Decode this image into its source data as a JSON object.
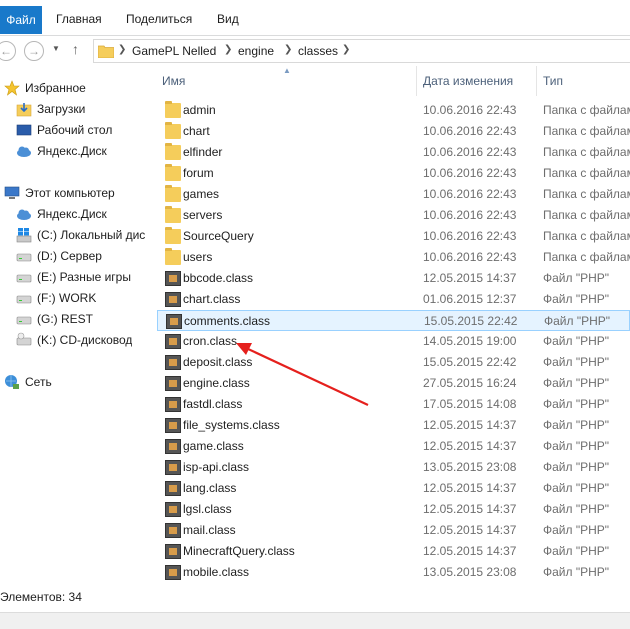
{
  "ribbon": {
    "tabs": [
      {
        "label": "Файл"
      },
      {
        "label": "Главная"
      },
      {
        "label": "Поделиться"
      },
      {
        "label": "Вид"
      }
    ]
  },
  "address": {
    "crumbs": [
      "GamePL Nelled",
      "engine",
      "classes"
    ]
  },
  "navpane": {
    "items": [
      {
        "label": "Избранное",
        "icon": "star-icon"
      },
      {
        "label": "Загрузки",
        "icon": "downloads-icon"
      },
      {
        "label": "Рабочий стол",
        "icon": "desktop-icon"
      },
      {
        "label": "Яндекс.Диск",
        "icon": "cloud-icon"
      },
      {
        "label": "Этот компьютер",
        "icon": "computer-icon"
      },
      {
        "label": "Яндекс.Диск",
        "icon": "cloud-icon"
      },
      {
        "label": "(C:) Локальный дис",
        "icon": "windows-drive-icon"
      },
      {
        "label": "(D:) Сервер",
        "icon": "drive-icon"
      },
      {
        "label": "(E:) Разные игры",
        "icon": "drive-icon"
      },
      {
        "label": "(F:) WORK",
        "icon": "drive-icon"
      },
      {
        "label": "(G:) REST",
        "icon": "drive-icon"
      },
      {
        "label": "(K:) CD-дисковод",
        "icon": "cd-drive-icon"
      },
      {
        "label": "Сеть",
        "icon": "network-icon"
      }
    ]
  },
  "columns": {
    "name": "Имя",
    "date": "Дата изменения",
    "type": "Тип"
  },
  "files": [
    {
      "name": "admin",
      "date": "10.06.2016 22:43",
      "type": "Папка с файлами",
      "kind": "folder"
    },
    {
      "name": "chart",
      "date": "10.06.2016 22:43",
      "type": "Папка с файлами",
      "kind": "folder"
    },
    {
      "name": "elfinder",
      "date": "10.06.2016 22:43",
      "type": "Папка с файлами",
      "kind": "folder"
    },
    {
      "name": "forum",
      "date": "10.06.2016 22:43",
      "type": "Папка с файлами",
      "kind": "folder"
    },
    {
      "name": "games",
      "date": "10.06.2016 22:43",
      "type": "Папка с файлами",
      "kind": "folder"
    },
    {
      "name": "servers",
      "date": "10.06.2016 22:43",
      "type": "Папка с файлами",
      "kind": "folder"
    },
    {
      "name": "SourceQuery",
      "date": "10.06.2016 22:43",
      "type": "Папка с файлами",
      "kind": "folder"
    },
    {
      "name": "users",
      "date": "10.06.2016 22:43",
      "type": "Папка с файлами",
      "kind": "folder"
    },
    {
      "name": "bbcode.class",
      "date": "12.05.2015 14:37",
      "type": "Файл \"PHP\"",
      "kind": "php"
    },
    {
      "name": "chart.class",
      "date": "01.06.2015 12:37",
      "type": "Файл \"PHP\"",
      "kind": "php"
    },
    {
      "name": "comments.class",
      "date": "15.05.2015 22:42",
      "type": "Файл \"PHP\"",
      "kind": "php",
      "selected": true
    },
    {
      "name": "cron.class",
      "date": "14.05.2015 19:00",
      "type": "Файл \"PHP\"",
      "kind": "php"
    },
    {
      "name": "deposit.class",
      "date": "15.05.2015 22:42",
      "type": "Файл \"PHP\"",
      "kind": "php"
    },
    {
      "name": "engine.class",
      "date": "27.05.2015 16:24",
      "type": "Файл \"PHP\"",
      "kind": "php"
    },
    {
      "name": "fastdl.class",
      "date": "17.05.2015 14:08",
      "type": "Файл \"PHP\"",
      "kind": "php"
    },
    {
      "name": "file_systems.class",
      "date": "12.05.2015 14:37",
      "type": "Файл \"PHP\"",
      "kind": "php"
    },
    {
      "name": "game.class",
      "date": "12.05.2015 14:37",
      "type": "Файл \"PHP\"",
      "kind": "php"
    },
    {
      "name": "isp-api.class",
      "date": "13.05.2015 23:08",
      "type": "Файл \"PHP\"",
      "kind": "php"
    },
    {
      "name": "lang.class",
      "date": "12.05.2015 14:37",
      "type": "Файл \"PHP\"",
      "kind": "php"
    },
    {
      "name": "lgsl.class",
      "date": "12.05.2015 14:37",
      "type": "Файл \"PHP\"",
      "kind": "php"
    },
    {
      "name": "mail.class",
      "date": "12.05.2015 14:37",
      "type": "Файл \"PHP\"",
      "kind": "php"
    },
    {
      "name": "MinecraftQuery.class",
      "date": "12.05.2015 14:37",
      "type": "Файл \"PHP\"",
      "kind": "php"
    },
    {
      "name": "mobile.class",
      "date": "13.05.2015 23:08",
      "type": "Файл \"PHP\"",
      "kind": "php"
    }
  ],
  "status": {
    "items_count": "Элементов: 34"
  },
  "colors": {
    "file_tab": "#1979ca",
    "selection_bg": "#e5f3ff",
    "selection_border": "#99d1ff",
    "annotation_arrow": "#e5201d"
  }
}
